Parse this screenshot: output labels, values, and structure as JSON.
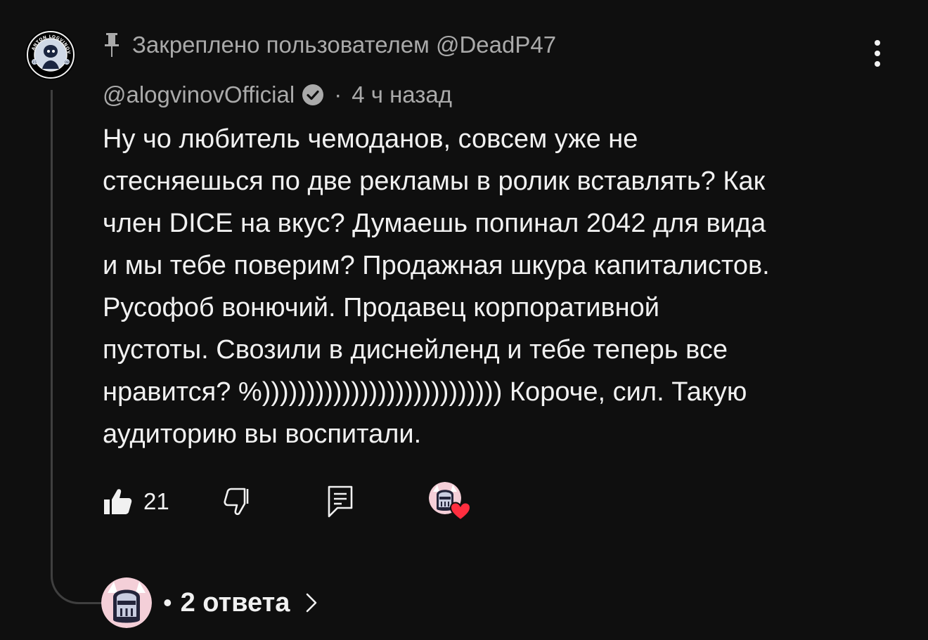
{
  "comment": {
    "pinned_text": "Закреплено пользователем @DeadP47",
    "author": "@alogvinovOfficial",
    "time": "4 ч назад",
    "separator": "·",
    "lines": [
      "Ну чо любитель чемоданов, совсем уже не",
      "стесняешься по две рекламы в ролик вставлять? Как",
      "член DICE на вкус? Думаешь попинал 2042 для вида",
      "и мы тебе поверим? Продажная шкура капиталистов.",
      "Русофоб вонючий. Продавец корпоративной",
      "пустоты. Свозили в диснейленд и тебе теперь все",
      "нравится? %))))))))))))))))))))))))))) Короче, сил. Такую",
      "аудиторию вы воспитали."
    ],
    "avatar_logo_text": "ANTON LOGVINOV",
    "avatar_badge_left": "15",
    "avatar_badge_right": "08"
  },
  "actions": {
    "like_count": "21",
    "like_icon": "thumb-up-filled-icon",
    "dislike_icon": "thumb-down-outline-icon",
    "reply_icon": "comment-reply-icon",
    "creator_heart_icon": "heart-icon"
  },
  "replies": {
    "separator": "•",
    "count_label": "2 ответа",
    "chevron_icon": "chevron-right-icon"
  },
  "colors": {
    "background": "#0f0f0f",
    "primary_text": "#f1f1f1",
    "secondary_text": "#aaaaaa",
    "thread_line": "#3f3f3f",
    "heart": "#ff2e3f",
    "avatar_knight_bg": "#f4cfd8"
  }
}
